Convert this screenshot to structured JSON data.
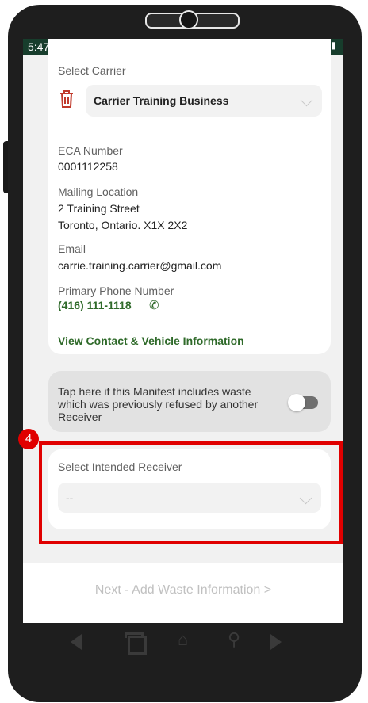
{
  "status_bar": {
    "time": "5:47",
    "settings_icon": "gear-icon",
    "right_icons": "▼◢▮"
  },
  "carrier": {
    "select_label": "Select Carrier",
    "selected_value": "Carrier Training Business",
    "eca_label": "ECA Number",
    "eca_value": "0001112258",
    "mailing_label": "Mailing Location",
    "mailing_line1": "2 Training Street",
    "mailing_line2": "Toronto, Ontario. X1X 2X2",
    "email_label": "Email",
    "email_value": "carrie.training.carrier@gmail.com",
    "phone_label": "Primary Phone Number",
    "phone_value": "(416) 111-1118",
    "view_link": "View Contact & Vehicle Information"
  },
  "refused": {
    "text": "Tap here if this Manifest includes waste which was previously refused by another Receiver",
    "toggle_on": false
  },
  "receiver": {
    "label": "Select Intended Receiver",
    "value": "--"
  },
  "annotation": {
    "step_number": "4",
    "color": "#e00000"
  },
  "footer": {
    "next_button": "Next - Add Waste Information  >"
  },
  "colors": {
    "status_bar": "#173d2c",
    "accent_green": "#2f6a2a",
    "delete_red": "#c0392b"
  }
}
